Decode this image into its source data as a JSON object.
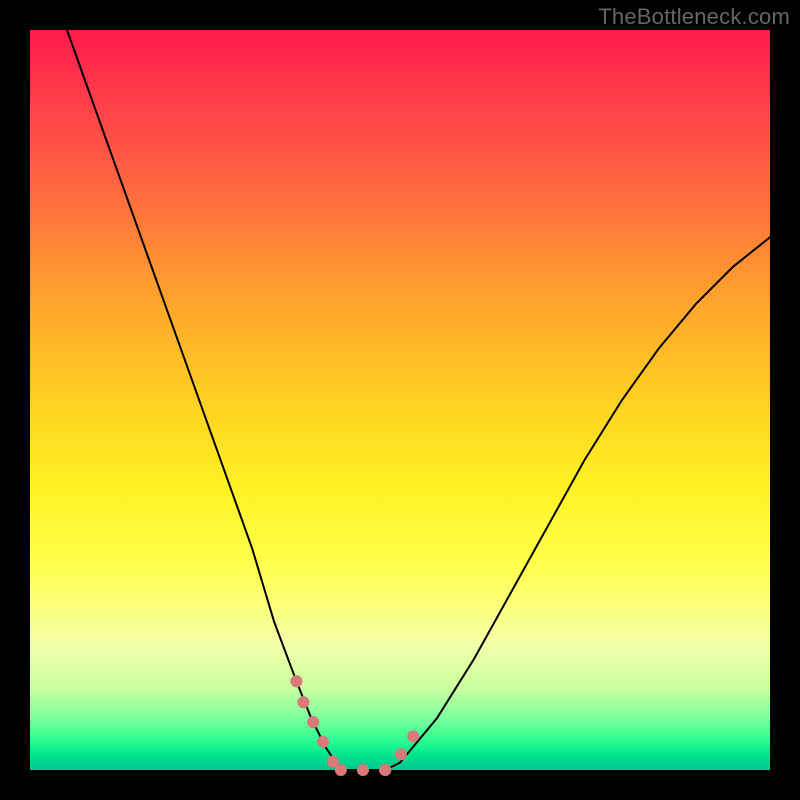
{
  "watermark": "TheBottleneck.com",
  "colors": {
    "frame": "#000000",
    "curve": "#000000",
    "dots": "#d87a7a"
  },
  "chart_data": {
    "type": "line",
    "title": "",
    "xlabel": "",
    "ylabel": "",
    "xlim": [
      0,
      100
    ],
    "ylim": [
      0,
      100
    ],
    "grid": false,
    "legend": false,
    "series": [
      {
        "name": "bottleneck-curve",
        "x": [
          5,
          10,
          15,
          20,
          25,
          30,
          33,
          36,
          38,
          40,
          42,
          45,
          48,
          50,
          55,
          60,
          65,
          70,
          75,
          80,
          85,
          90,
          95,
          100
        ],
        "y": [
          100,
          86,
          72,
          58,
          44,
          30,
          20,
          12,
          7,
          3,
          0,
          0,
          0,
          1,
          7,
          15,
          24,
          33,
          42,
          50,
          57,
          63,
          68,
          72
        ]
      }
    ],
    "highlight_segments": [
      {
        "name": "left-arm-dots",
        "x": [
          36,
          37,
          38,
          39,
          40,
          41,
          42
        ],
        "y": [
          12,
          9,
          7,
          5,
          3,
          1,
          0
        ]
      },
      {
        "name": "valley-floor-dots",
        "x": [
          42,
          43.5,
          45,
          46.5,
          48
        ],
        "y": [
          0,
          0,
          0,
          0,
          0
        ]
      },
      {
        "name": "right-arm-dots",
        "x": [
          48,
          49,
          50,
          51,
          52,
          53
        ],
        "y": [
          0,
          1,
          2,
          3,
          5,
          6
        ]
      }
    ],
    "note": "Values read approximately from the plotted curve; x in 0–100 fraction of width, y in 0–100 fraction of height (0 at bottom)."
  }
}
